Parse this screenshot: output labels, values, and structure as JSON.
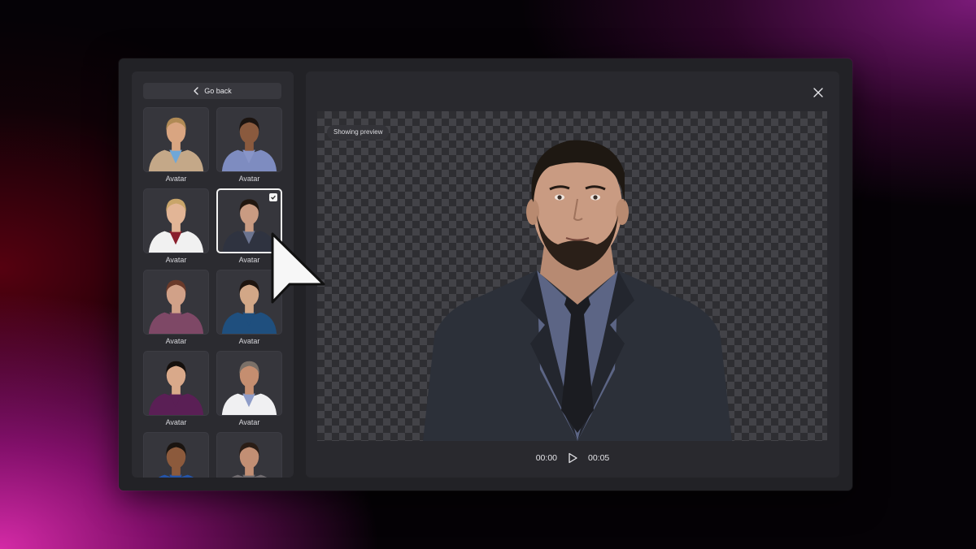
{
  "sidebar": {
    "go_back_label": "Go back",
    "avatars": [
      {
        "label": "Avatar",
        "selected": false,
        "skin": "#d9a581",
        "hair": "#b08a55",
        "shirt": "#c4a888",
        "inner": "#6fa7d8"
      },
      {
        "label": "Avatar",
        "selected": false,
        "skin": "#8a5a3e",
        "hair": "#1c1410",
        "shirt": "#7e8cc0",
        "inner": "#8895c8"
      },
      {
        "label": "Avatar",
        "selected": false,
        "skin": "#e2b596",
        "hair": "#c9a56a",
        "shirt": "#f1f1f1",
        "inner": "#8a1f2c"
      },
      {
        "label": "Avatar",
        "selected": true,
        "skin": "#c99b82",
        "hair": "#20160f",
        "shirt": "#2f3340",
        "inner": "#6b7490"
      },
      {
        "label": "Avatar",
        "selected": false,
        "skin": "#d1a188",
        "hair": "#6a3a2a",
        "shirt": "#7e4866",
        "inner": "#7e4866"
      },
      {
        "label": "Avatar",
        "selected": false,
        "skin": "#d2a787",
        "hair": "#1e140e",
        "shirt": "#1f4f7e",
        "inner": "#1f4f7e"
      },
      {
        "label": "Avatar",
        "selected": false,
        "skin": "#d9a98a",
        "hair": "#15100d",
        "shirt": "#5a1f55",
        "inner": "#5a1f55"
      },
      {
        "label": "Avatar",
        "selected": false,
        "skin": "#c58e70",
        "hair": "#7a7068",
        "shirt": "#f0f0f2",
        "inner": "#8e9cc8"
      },
      {
        "label": "",
        "selected": false,
        "skin": "#8c5a3c",
        "hair": "#1a1410",
        "shirt": "#2454a8",
        "inner": "#2454a8"
      },
      {
        "label": "",
        "selected": false,
        "skin": "#c28f74",
        "hair": "#2a1d16",
        "shirt": "#6e6a6e",
        "inner": "#6e6a6e"
      }
    ]
  },
  "preview": {
    "badge": "Showing preview",
    "time_current": "00:00",
    "time_total": "00:05"
  },
  "icons": {
    "back": "chevron-left-icon",
    "close": "close-icon",
    "play": "play-icon",
    "check": "checkmark-icon",
    "cursor": "mouse-pointer-icon"
  }
}
